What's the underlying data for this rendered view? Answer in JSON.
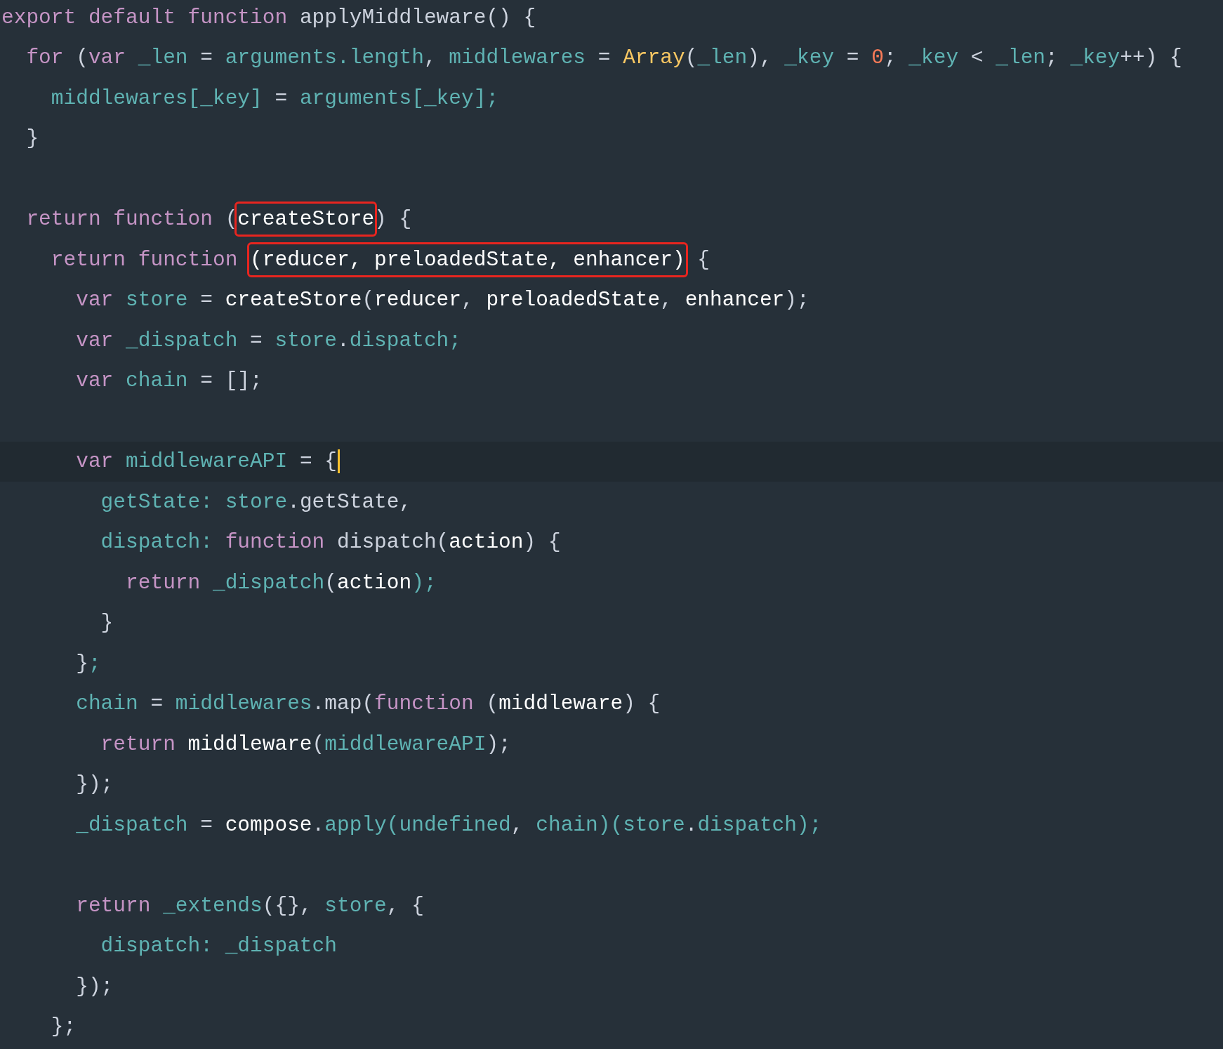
{
  "editor": {
    "lines": [
      {
        "kind": "code",
        "tokens": [
          {
            "kind": "kw",
            "text": "export default function "
          },
          {
            "kind": "fn",
            "text": "applyMiddleware() {"
          }
        ]
      },
      {
        "kind": "code",
        "tokens": [
          {
            "kind": "kw",
            "text": "  for "
          },
          {
            "kind": "punct",
            "text": "("
          },
          {
            "kind": "kw",
            "text": "var "
          },
          {
            "kind": "id",
            "text": "_len "
          },
          {
            "kind": "punct",
            "text": "= "
          },
          {
            "kind": "id",
            "text": "arguments.length"
          },
          {
            "kind": "punct",
            "text": ", "
          },
          {
            "kind": "id",
            "text": "middlewares "
          },
          {
            "kind": "punct",
            "text": "= "
          },
          {
            "kind": "cls",
            "text": "Array"
          },
          {
            "kind": "punct",
            "text": "("
          },
          {
            "kind": "id",
            "text": "_len"
          },
          {
            "kind": "punct",
            "text": "), "
          },
          {
            "kind": "id",
            "text": "_key "
          },
          {
            "kind": "punct",
            "text": "= "
          },
          {
            "kind": "num",
            "text": "0"
          },
          {
            "kind": "punct",
            "text": "; "
          },
          {
            "kind": "id",
            "text": "_key "
          },
          {
            "kind": "punct",
            "text": "< "
          },
          {
            "kind": "id",
            "text": "_len"
          },
          {
            "kind": "punct",
            "text": "; "
          },
          {
            "kind": "id",
            "text": "_key"
          },
          {
            "kind": "punct",
            "text": "++) {"
          }
        ]
      },
      {
        "kind": "code",
        "tokens": [
          {
            "kind": "id",
            "text": "    middlewares[_key] "
          },
          {
            "kind": "punct",
            "text": "= "
          },
          {
            "kind": "id",
            "text": "arguments[_key];"
          }
        ]
      },
      {
        "kind": "code",
        "tokens": [
          {
            "kind": "punct",
            "text": "  }"
          }
        ]
      },
      {
        "kind": "blank"
      },
      {
        "kind": "code",
        "tokens": [
          {
            "kind": "kw",
            "text": "  return function "
          },
          {
            "kind": "punct",
            "text": "("
          },
          {
            "kind": "param",
            "text": "createStore",
            "boxed": true
          },
          {
            "kind": "punct",
            "text": ") {"
          }
        ]
      },
      {
        "kind": "code",
        "tokens": [
          {
            "kind": "kw",
            "text": "    return function "
          },
          {
            "kind": "param",
            "text": "(reducer, preloadedState, enhancer)",
            "boxed": true
          },
          {
            "kind": "punct",
            "text": " {"
          }
        ]
      },
      {
        "kind": "code",
        "tokens": [
          {
            "kind": "kw",
            "text": "      var "
          },
          {
            "kind": "id",
            "text": "store "
          },
          {
            "kind": "punct",
            "text": "= "
          },
          {
            "kind": "param",
            "text": "createStore"
          },
          {
            "kind": "punct",
            "text": "("
          },
          {
            "kind": "param",
            "text": "reducer"
          },
          {
            "kind": "punct",
            "text": ", "
          },
          {
            "kind": "param",
            "text": "preloadedState"
          },
          {
            "kind": "punct",
            "text": ", "
          },
          {
            "kind": "param",
            "text": "enhancer"
          },
          {
            "kind": "punct",
            "text": ");"
          }
        ]
      },
      {
        "kind": "code",
        "tokens": [
          {
            "kind": "kw",
            "text": "      var "
          },
          {
            "kind": "id",
            "text": "_dispatch "
          },
          {
            "kind": "punct",
            "text": "= "
          },
          {
            "kind": "id",
            "text": "store"
          },
          {
            "kind": "punct",
            "text": "."
          },
          {
            "kind": "id",
            "text": "dispatch;"
          }
        ]
      },
      {
        "kind": "code",
        "tokens": [
          {
            "kind": "kw",
            "text": "      var "
          },
          {
            "kind": "id",
            "text": "chain "
          },
          {
            "kind": "punct",
            "text": "= [];"
          }
        ]
      },
      {
        "kind": "blank"
      },
      {
        "kind": "current",
        "tokens": [
          {
            "kind": "kw",
            "text": "      var "
          },
          {
            "kind": "id",
            "text": "middlewareAPI "
          },
          {
            "kind": "punct",
            "text": "= {"
          }
        ]
      },
      {
        "kind": "code",
        "tokens": [
          {
            "kind": "id",
            "text": "        getState: store"
          },
          {
            "kind": "punct",
            "text": "."
          },
          {
            "kind": "fn",
            "text": "getState,"
          }
        ]
      },
      {
        "kind": "code",
        "tokens": [
          {
            "kind": "id",
            "text": "        dispatch: "
          },
          {
            "kind": "kw",
            "text": "function "
          },
          {
            "kind": "fn",
            "text": "dispatch("
          },
          {
            "kind": "param",
            "text": "action"
          },
          {
            "kind": "fn",
            "text": ") {"
          }
        ]
      },
      {
        "kind": "code",
        "tokens": [
          {
            "kind": "kw",
            "text": "          return "
          },
          {
            "kind": "id",
            "text": "_dispatch"
          },
          {
            "kind": "punct",
            "text": "("
          },
          {
            "kind": "param",
            "text": "action"
          },
          {
            "kind": "id",
            "text": ");"
          }
        ]
      },
      {
        "kind": "code",
        "tokens": [
          {
            "kind": "punct",
            "text": "        }"
          }
        ]
      },
      {
        "kind": "code",
        "tokens": [
          {
            "kind": "punct",
            "text": "      }"
          },
          {
            "kind": "id",
            "text": ";"
          }
        ]
      },
      {
        "kind": "code",
        "tokens": [
          {
            "kind": "id",
            "text": "      chain "
          },
          {
            "kind": "punct",
            "text": "= "
          },
          {
            "kind": "id",
            "text": "middlewares"
          },
          {
            "kind": "punct",
            "text": "."
          },
          {
            "kind": "fn",
            "text": "map"
          },
          {
            "kind": "punct",
            "text": "("
          },
          {
            "kind": "kw",
            "text": "function "
          },
          {
            "kind": "punct",
            "text": "("
          },
          {
            "kind": "param",
            "text": "middleware"
          },
          {
            "kind": "punct",
            "text": ") {"
          }
        ]
      },
      {
        "kind": "code",
        "tokens": [
          {
            "kind": "kw",
            "text": "        return "
          },
          {
            "kind": "param",
            "text": "middleware"
          },
          {
            "kind": "punct",
            "text": "("
          },
          {
            "kind": "id",
            "text": "middlewareAPI"
          },
          {
            "kind": "punct",
            "text": ");"
          }
        ]
      },
      {
        "kind": "code",
        "tokens": [
          {
            "kind": "punct",
            "text": "      });"
          }
        ]
      },
      {
        "kind": "code",
        "tokens": [
          {
            "kind": "id",
            "text": "      _dispatch "
          },
          {
            "kind": "punct",
            "text": "= "
          },
          {
            "kind": "param",
            "text": "compose"
          },
          {
            "kind": "punct",
            "text": "."
          },
          {
            "kind": "id",
            "text": "apply(undefined"
          },
          {
            "kind": "punct",
            "text": ", "
          },
          {
            "kind": "id",
            "text": "chain)(store"
          },
          {
            "kind": "punct",
            "text": "."
          },
          {
            "kind": "id",
            "text": "dispatch);"
          }
        ]
      },
      {
        "kind": "blank"
      },
      {
        "kind": "code",
        "tokens": [
          {
            "kind": "kw",
            "text": "      return "
          },
          {
            "kind": "id",
            "text": "_extends"
          },
          {
            "kind": "punct",
            "text": "({}, "
          },
          {
            "kind": "id",
            "text": "store"
          },
          {
            "kind": "punct",
            "text": ", {"
          }
        ]
      },
      {
        "kind": "code",
        "tokens": [
          {
            "kind": "id",
            "text": "        dispatch: _dispatch"
          }
        ]
      },
      {
        "kind": "code",
        "tokens": [
          {
            "kind": "punct",
            "text": "      });"
          }
        ]
      },
      {
        "kind": "code",
        "tokens": [
          {
            "kind": "punct",
            "text": "    };"
          }
        ]
      }
    ]
  }
}
